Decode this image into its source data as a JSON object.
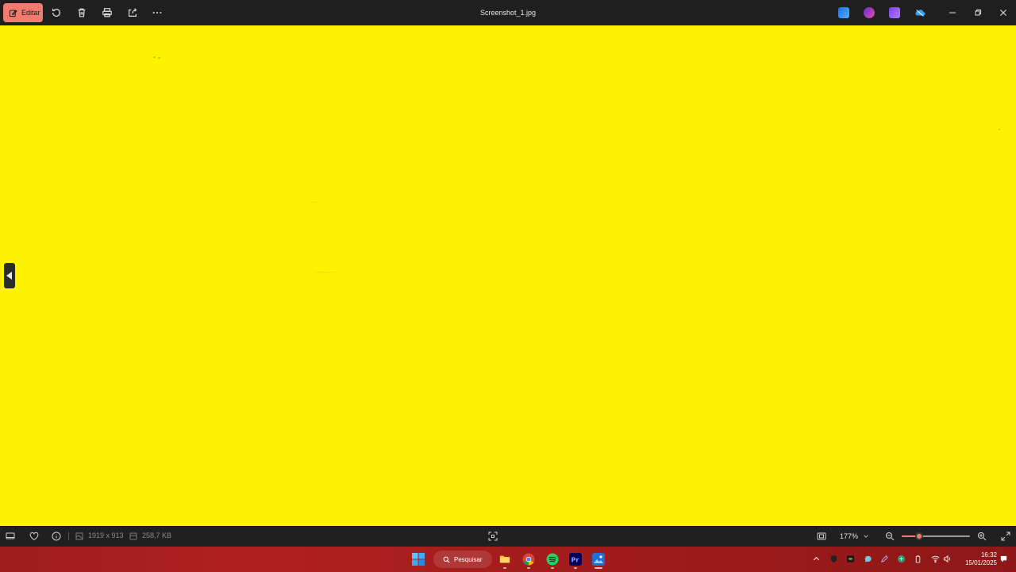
{
  "toolbar": {
    "edit_label": "Editar",
    "title": "Screenshot_1.jpg"
  },
  "canvas": {
    "background": "#fdf200"
  },
  "status": {
    "dimensions": "1919 x 913",
    "file_size": "258,7 KB",
    "zoom": "177%",
    "zoom_slider_fraction": 0.26
  },
  "taskbar": {
    "search_label": "Pesquisar",
    "time": "16:32",
    "date": "15/01/2025"
  },
  "colors": {
    "accent": "#f07b6e",
    "taskbar": "#a31c1c",
    "topbar": "#1f1f1f"
  }
}
